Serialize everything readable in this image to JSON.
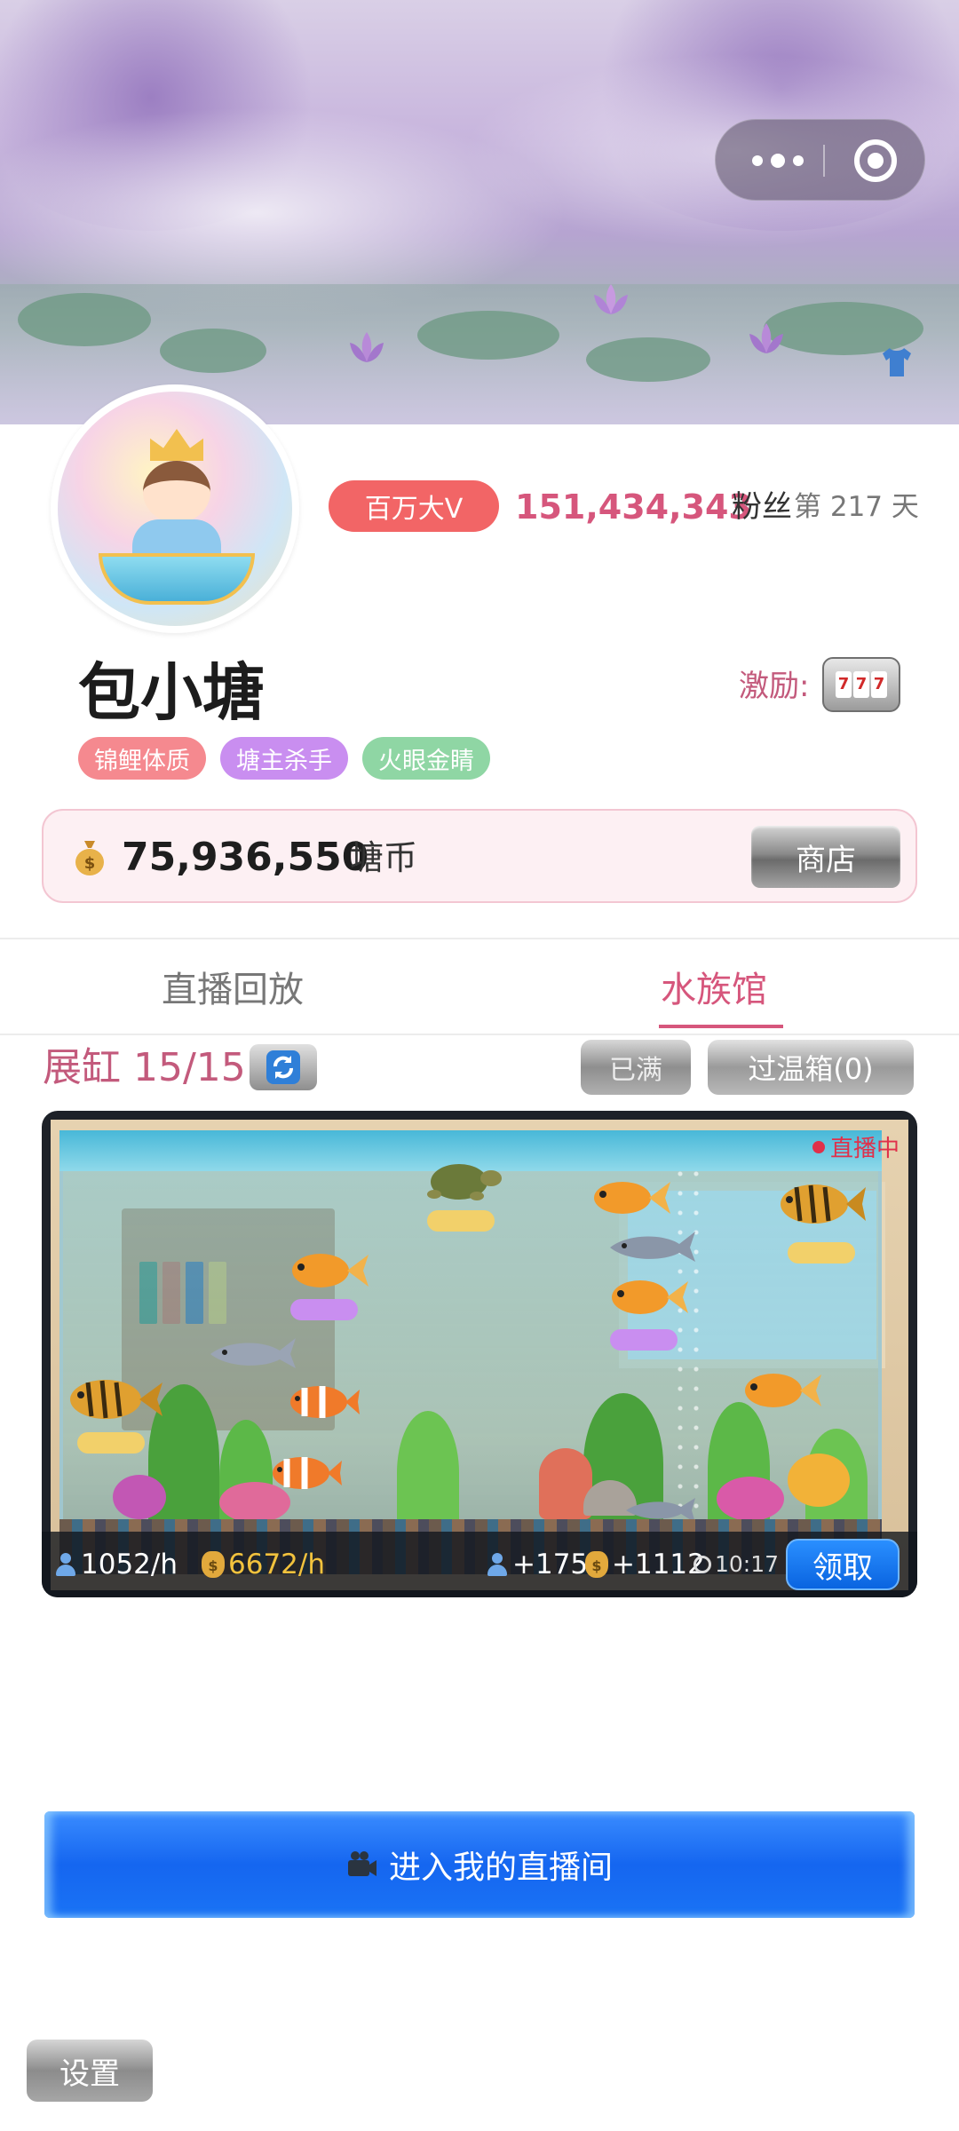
{
  "header": {
    "banner_alt": "watercolor lotus pond",
    "capsule": {
      "more_icon": "more-dots-icon",
      "close_icon": "target-circle-icon"
    },
    "outfit_icon": "shirt-icon"
  },
  "profile": {
    "vip_badge": "百万大V",
    "fans_count": "151,434,343",
    "fans_label": "粉丝",
    "day_text": "第 217 天",
    "username": "包小塘",
    "incentive_label": "激励:",
    "slot_icon": "slot-machine-icon",
    "tags": [
      {
        "label": "锦鲤体质",
        "color": "#f5898f"
      },
      {
        "label": "塘主杀手",
        "color": "#c98ef0"
      },
      {
        "label": "火眼金睛",
        "color": "#8fd6a4"
      }
    ]
  },
  "wallet": {
    "amount": "75,936,550",
    "unit": "塘币",
    "shop_label": "商店"
  },
  "tabs": [
    {
      "label": "直播回放",
      "active": false
    },
    {
      "label": "水族馆",
      "active": true
    }
  ],
  "tank": {
    "label": "展缸 15/15",
    "full_label": "已满",
    "quarantine_label": "过温箱(0)",
    "live_label": "直播中",
    "stats": {
      "viewers_rate": "1052/h",
      "coins_rate": "6672/h",
      "viewers_gain": "+175",
      "coins_gain": "+1112",
      "timer": "10:17"
    },
    "claim_label": "领取"
  },
  "actions": {
    "enter_live_label": "进入我的直播间",
    "settings_label": "设置"
  },
  "colors": {
    "accent_pink": "#d6567c",
    "badge_red": "#f26566",
    "primary_blue": "#1566f0"
  }
}
